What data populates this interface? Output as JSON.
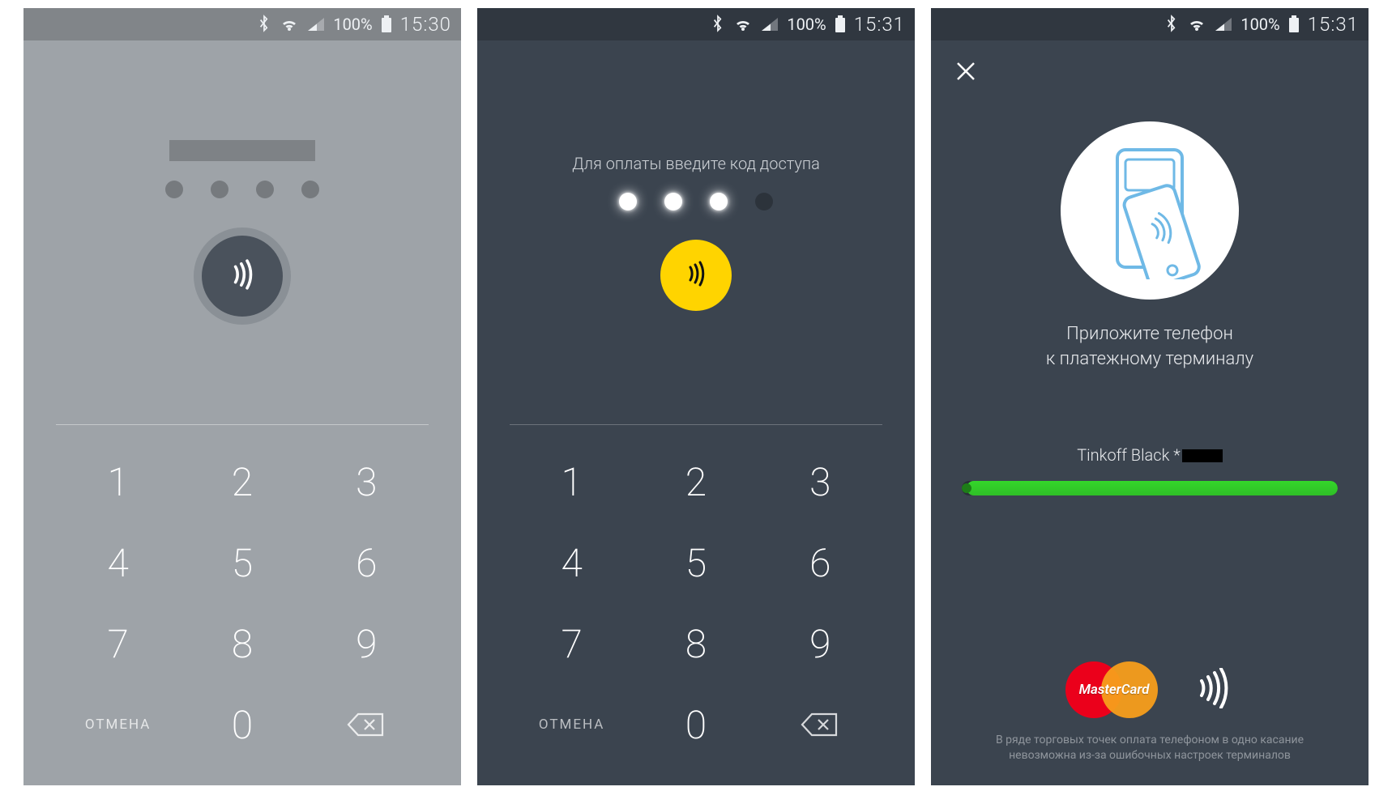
{
  "status": {
    "battery_pct": "100%",
    "time1": "15:30",
    "time2": "15:31",
    "time3": "15:31"
  },
  "screen1": {
    "cancel": "ОТМЕНА",
    "keys": [
      "1",
      "2",
      "3",
      "4",
      "5",
      "6",
      "7",
      "8",
      "9",
      "0"
    ]
  },
  "screen2": {
    "instruction": "Для оплаты введите код доступа",
    "entered": 3,
    "cancel": "ОТМЕНА",
    "keys": [
      "1",
      "2",
      "3",
      "4",
      "5",
      "6",
      "7",
      "8",
      "9",
      "0"
    ]
  },
  "screen3": {
    "msg_line1": "Приложите телефон",
    "msg_line2": "к платежному терминалу",
    "card_label": "Tinkoff Black *",
    "brand": "MasterCard",
    "disclaimer_line1": "В ряде торговых точек оплата телефоном в одно касание",
    "disclaimer_line2": "невозможна из-за ошибочных настроек терминалов"
  }
}
